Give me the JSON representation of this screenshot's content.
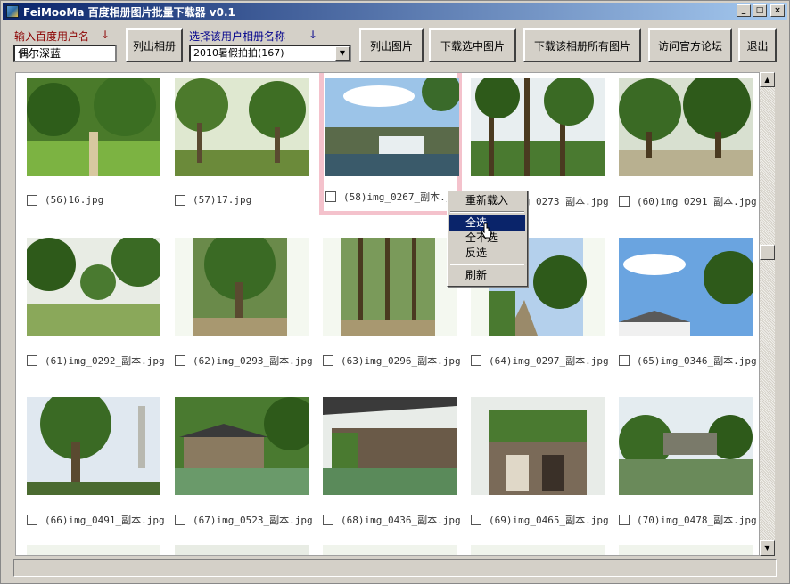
{
  "window": {
    "title": "FeiMooMa 百度相册图片批量下载器 v0.1"
  },
  "toolbar": {
    "user_label": "输入百度用户名",
    "user_arrow": "↓",
    "user_value": "偶尔深蓝",
    "list_albums": "列出相册",
    "album_label": "选择该用户相册名称",
    "album_arrow": "↓",
    "album_value": "2010暑假拍拍(167)",
    "list_images": "列出图片",
    "download_selected": "下载选中图片",
    "download_all": "下载该相册所有图片",
    "visit_forum": "访问官方论坛",
    "exit": "退出"
  },
  "photos": [
    {
      "caption": "(56)16.jpg"
    },
    {
      "caption": "(57)17.jpg"
    },
    {
      "caption": "(58)img_0267_副本.jpg"
    },
    {
      "caption": "(59)img_0273_副本.jpg"
    },
    {
      "caption": "(60)img_0291_副本.jpg"
    },
    {
      "caption": "(61)img_0292_副本.jpg"
    },
    {
      "caption": "(62)img_0293_副本.jpg"
    },
    {
      "caption": "(63)img_0296_副本.jpg"
    },
    {
      "caption": "(64)img_0297_副本.jpg"
    },
    {
      "caption": "(65)img_0346_副本.jpg"
    },
    {
      "caption": "(66)img_0491_副本.jpg"
    },
    {
      "caption": "(67)img_0523_副本.jpg"
    },
    {
      "caption": "(68)img_0436_副本.jpg"
    },
    {
      "caption": "(69)img_0465_副本.jpg"
    },
    {
      "caption": "(70)img_0478_副本.jpg"
    }
  ],
  "context_menu": {
    "reload": "重新载入",
    "select_all": "全选",
    "select_none": "全不选",
    "invert": "反选",
    "refresh": "刷新"
  },
  "colors": {
    "title_gradient_start": "#0a246a",
    "title_gradient_end": "#a6caf0",
    "face": "#d4d0c8",
    "selection_border": "#f4c2cc",
    "menu_highlight": "#0a246a"
  }
}
